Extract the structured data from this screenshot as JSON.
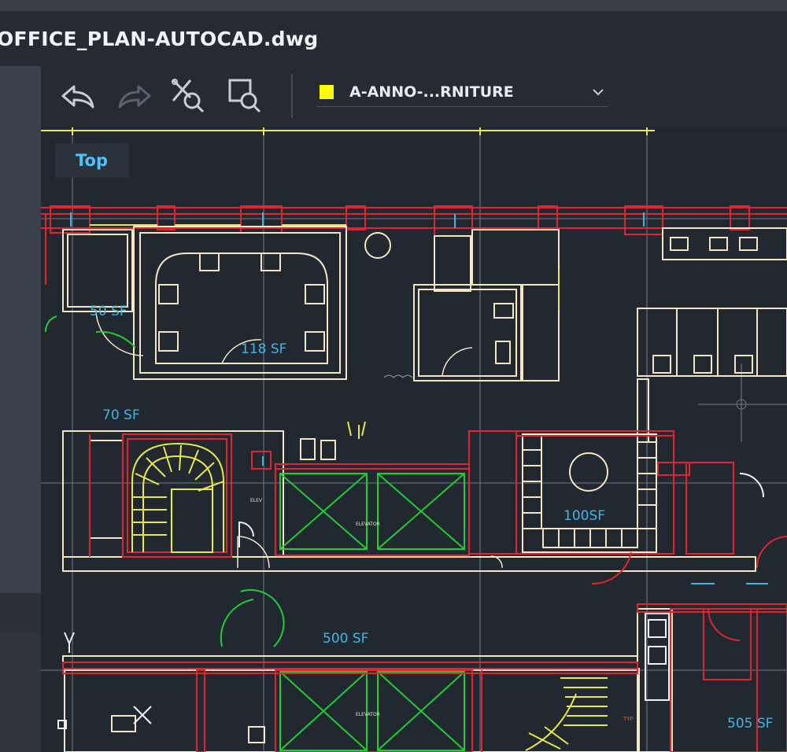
{
  "window": {
    "file_title": "OFFICE_PLAN-AUTOCAD.dwg"
  },
  "toolbar": {
    "undo_icon": "undo-arrow-icon",
    "redo_icon": "redo-arrow-icon",
    "measure_icon": "measure-zoom-icon",
    "select_zoom_icon": "zoom-window-icon",
    "layer": {
      "name": "A-ANNO-...RNITURE",
      "color": "#ffff00"
    }
  },
  "viewport": {
    "view_label": "Top"
  },
  "rooms": [
    {
      "label": "50 SF"
    },
    {
      "label": "118 SF"
    },
    {
      "label": "70 SF"
    },
    {
      "label": "100SF"
    },
    {
      "label": "500 SF"
    },
    {
      "label": "505 SF"
    }
  ],
  "colors": {
    "background": "#212830",
    "wall_red": "#e02430",
    "wall_yellow": "#ffff00",
    "furniture": "#f5e6c8",
    "elevator_green": "#22cc33",
    "grid_gray": "#8a8f98",
    "annotation_cyan": "#3fb6e8"
  }
}
